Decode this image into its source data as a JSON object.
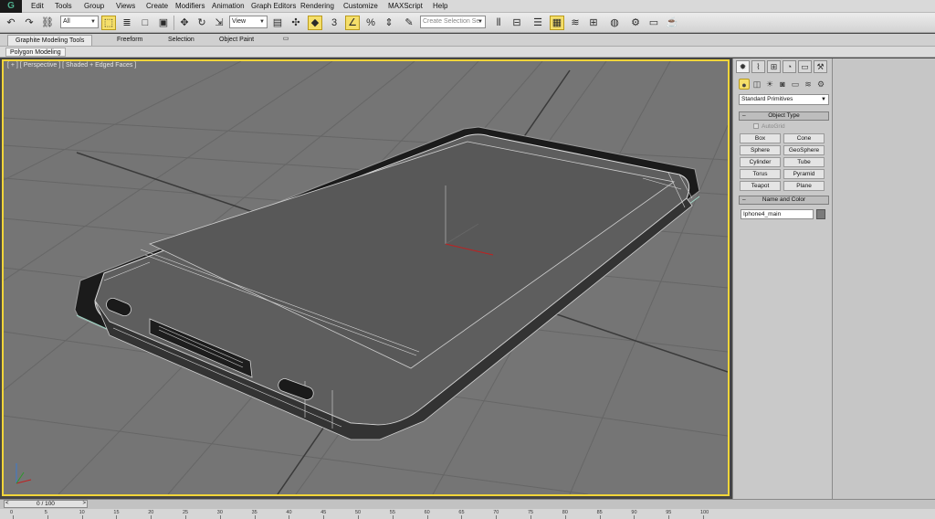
{
  "app": {
    "logo_text": "G"
  },
  "menu": [
    "Edit",
    "Tools",
    "Group",
    "Views",
    "Create",
    "Modifiers",
    "Animation",
    "Graph Editors",
    "Rendering",
    "Customize",
    "MAXScript",
    "Help"
  ],
  "toolbar": {
    "filter_value": "All",
    "reference_coord_value": "View",
    "snap_angle_label": "3",
    "selection_set_placeholder": "Create Selection Se"
  },
  "ribbon": {
    "tabs": [
      "Graphite Modeling Tools",
      "Freeform",
      "Selection",
      "Object Paint"
    ],
    "active_panel": "Polygon Modeling"
  },
  "viewport": {
    "label": "[ + ] [ Perspective ] [ Shaded + Edged Faces ]",
    "accent_color": "#f1d53a"
  },
  "command_panel": {
    "primitive_type": "Standard Primitives",
    "object_type_header": "Object Type",
    "autogrid_label": "AutoGrid",
    "primitives": [
      "Box",
      "Cone",
      "Sphere",
      "GeoSphere",
      "Cylinder",
      "Tube",
      "Torus",
      "Pyramid",
      "Teapot",
      "Plane"
    ],
    "name_color_header": "Name and Color",
    "object_name": "Iphone4_main",
    "object_color": "#7b7b7b"
  },
  "timeline": {
    "current_frame": "0 / 100",
    "ticks": [
      "0",
      "5",
      "10",
      "15",
      "20",
      "25",
      "30",
      "35",
      "40",
      "45",
      "50",
      "55",
      "60",
      "65",
      "70",
      "75",
      "80",
      "85",
      "90",
      "95",
      "100"
    ]
  }
}
